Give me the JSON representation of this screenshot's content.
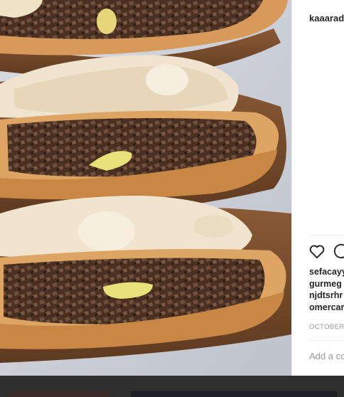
{
  "post": {
    "username": "kaaarad",
    "comments": [
      "sefacayy",
      "gurmeg",
      "njdtsrhr",
      "omercar"
    ],
    "date": "OCTOBER 2",
    "add_comment_placeholder": "Add a co"
  },
  "icons": {
    "like": "heart-icon",
    "comment": "comment-bubble-icon"
  },
  "colors": {
    "text": "#262626",
    "muted": "#999999",
    "divider": "#efefef",
    "backdrop": "#2e2e2e"
  }
}
